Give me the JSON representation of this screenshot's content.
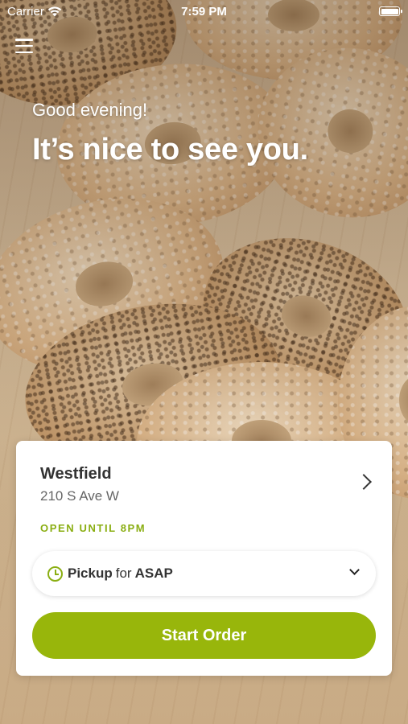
{
  "status_bar": {
    "carrier": "Carrier",
    "time": "7:59 PM",
    "wifi_icon": "wifi-icon",
    "battery_icon": "battery-icon"
  },
  "header": {
    "menu_icon": "hamburger-menu-icon"
  },
  "hero": {
    "greeting": "Good evening!",
    "headline": "It’s nice to see you."
  },
  "store_card": {
    "name": "Westfield",
    "address": "210 S Ave W",
    "hours_status": "OPEN UNTIL 8PM",
    "chevron_icon": "chevron-right-icon",
    "order_mode": {
      "mode": "Pickup",
      "connector": "for",
      "time": "ASAP",
      "clock_icon": "clock-icon",
      "dropdown_icon": "chevron-down-icon"
    },
    "start_button_label": "Start Order"
  },
  "colors": {
    "accent": "#98b60b",
    "hours_text": "#8aae12",
    "card_background": "#ffffff",
    "title_text": "#333333"
  }
}
